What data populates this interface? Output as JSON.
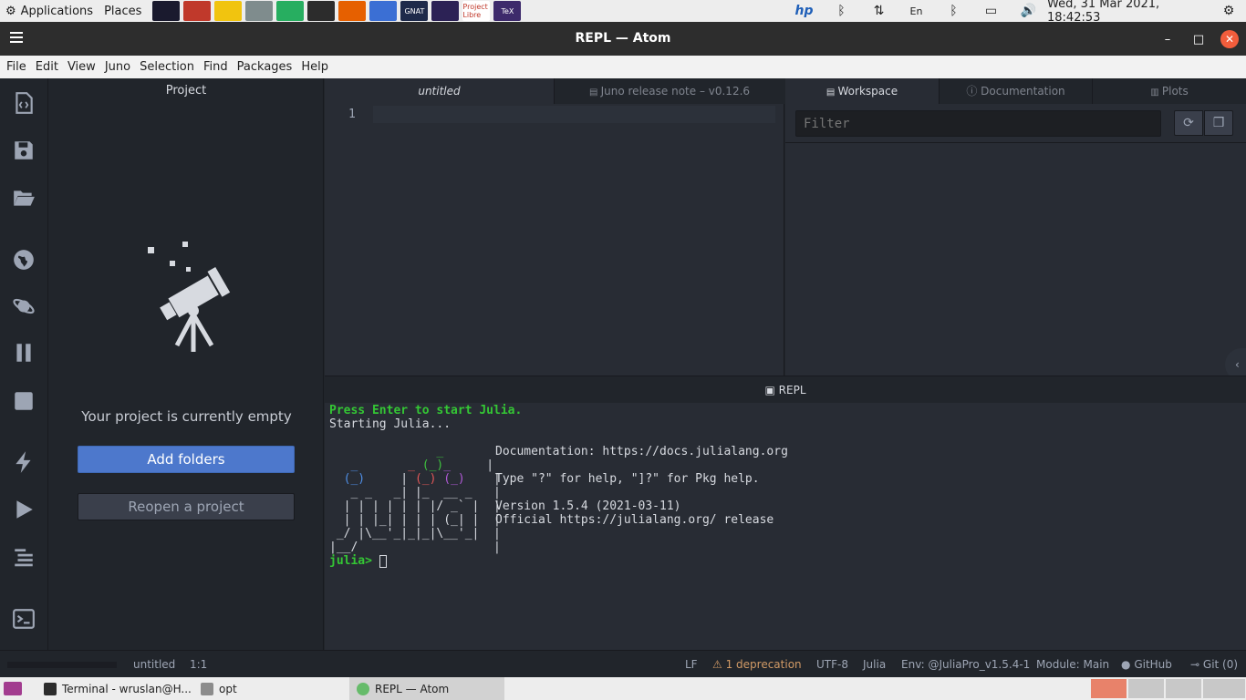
{
  "system_panel": {
    "applications": "Applications",
    "places": "Places",
    "launchers": [
      {
        "icon": "audio-visualizer-icon",
        "color": "#1a1a2e",
        "text": ""
      },
      {
        "icon": "archive-icon",
        "color": "#c0392b",
        "text": ""
      },
      {
        "icon": "pencil-icon",
        "color": "#f1c40f",
        "text": ""
      },
      {
        "icon": "camera-icon",
        "color": "#7f8c8d",
        "text": ""
      },
      {
        "icon": "green-swirl-icon",
        "color": "#27ae60",
        "text": ""
      },
      {
        "icon": "terminal-icon",
        "color": "#2c2c2c",
        "text": ""
      },
      {
        "icon": "firefox-icon",
        "color": "#e66000",
        "text": ""
      },
      {
        "icon": "document-icon",
        "color": "#3b6fd4",
        "text": ""
      },
      {
        "icon": "gnat-studio-icon",
        "color": "#1e2a4a",
        "text": "GNAT"
      },
      {
        "icon": "eclipse-icon",
        "color": "#2c2255",
        "text": ""
      },
      {
        "icon": "project-libre-icon",
        "color": "#ffffff",
        "text": "Project Libre"
      },
      {
        "icon": "texstudio-icon",
        "color": "#3d2a6b",
        "text": "TeX"
      }
    ],
    "tray": [
      {
        "icon": "hp-icon",
        "glyph": "hp"
      },
      {
        "icon": "bluetooth-icon",
        "glyph": "ᛒ"
      },
      {
        "icon": "network-arrows-icon",
        "glyph": "⇅"
      },
      {
        "icon": "keyboard-layout-icon",
        "glyph": "En"
      },
      {
        "icon": "bluetooth-icon",
        "glyph": "ᛒ"
      },
      {
        "icon": "battery-icon",
        "glyph": "▭"
      },
      {
        "icon": "volume-icon",
        "glyph": "🔊"
      }
    ],
    "clock": "Wed, 31 Mar 2021, 18:42:53",
    "settings_glyph": "⚙"
  },
  "window": {
    "title": "REPL — Atom",
    "minimize": "–",
    "maximize": "□",
    "close": "✕"
  },
  "menu": [
    "File",
    "Edit",
    "View",
    "Juno",
    "Selection",
    "Find",
    "Packages",
    "Help"
  ],
  "toolbar": {
    "icons": [
      "new-file-icon",
      "save-icon",
      "open-folder-icon",
      "globe-icon",
      "planet-icon",
      "pause-icon",
      "stop-icon",
      "flash-icon",
      "play-icon",
      "outline-icon",
      "terminal-icon"
    ]
  },
  "project": {
    "title": "Project",
    "empty_message": "Your project is currently empty",
    "add_folders": "Add folders",
    "reopen": "Reopen a project"
  },
  "editor": {
    "tabs": [
      {
        "label": "untitled",
        "icon": ""
      },
      {
        "label": "Juno release note – v0.12.6",
        "icon": "📖"
      }
    ],
    "line_number": "1"
  },
  "workspace": {
    "tabs": [
      {
        "label": "Workspace",
        "icon": "📖"
      },
      {
        "label": "Documentation",
        "icon": "ⓘ"
      },
      {
        "label": "Plots",
        "icon": "📊"
      }
    ],
    "filter_placeholder": "Filter",
    "refresh_glyph": "⟳",
    "box_glyph": "❒",
    "collapse_glyph": "‹"
  },
  "repl": {
    "header": "REPL",
    "header_icon": "▣",
    "line_start": "Press Enter to start Julia.",
    "line_starting": "Starting Julia...",
    "doc_line": "Documentation: https://docs.julialang.org",
    "help_line": "Type \"?\" for help, \"]?\" for Pkg help.",
    "version_line": "Version 1.5.4 (2021-03-11)",
    "release_line": "Official https://julialang.org/ release",
    "prompt": "julia>"
  },
  "status": {
    "file": "untitled",
    "position": "1:1",
    "line_ending": "LF",
    "deprecation": "1 deprecation",
    "encoding": "UTF-8",
    "grammar": "Julia",
    "env": "Env: @JuliaPro_v1.5.4-1",
    "module": "Module: Main",
    "github": "GitHub",
    "git": "Git (0)"
  },
  "taskbar": {
    "tasks": [
      {
        "label": "Terminal - wruslan@H...",
        "icon": "terminal-icon"
      },
      {
        "label": "opt",
        "icon": "folder-icon"
      },
      {
        "label": "REPL — Atom",
        "icon": "atom-icon"
      }
    ]
  }
}
